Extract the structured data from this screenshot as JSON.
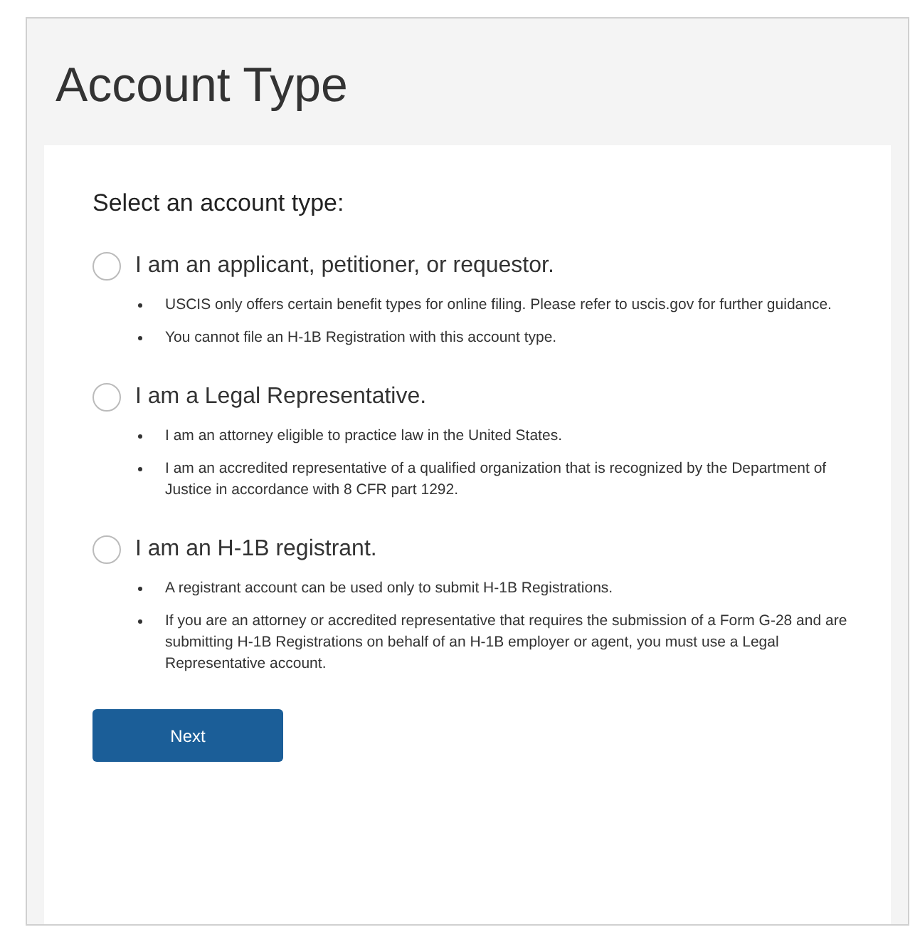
{
  "title": "Account Type",
  "prompt": "Select an account type:",
  "options": [
    {
      "label": "I am an applicant, petitioner, or requestor.",
      "selected": false,
      "bullets": [
        "USCIS only offers certain benefit types for online filing. Please refer to uscis.gov for further guidance.",
        "You cannot file an H-1B Registration with this account type."
      ]
    },
    {
      "label": "I am a Legal Representative.",
      "selected": false,
      "bullets": [
        "I am an attorney eligible to practice law in the United States.",
        "I am an accredited representative of a qualified organization that is recognized by the Department of Justice in accordance with 8 CFR part 1292."
      ]
    },
    {
      "label": "I am an H-1B registrant.",
      "selected": false,
      "bullets": [
        "A registrant account can be used only to submit H-1B Registrations.",
        "If you are an attorney or accredited representative that requires the submission of a Form G-28 and are submitting H-1B Registrations on behalf of an H-1B employer or agent, you must use a Legal Representative account."
      ]
    }
  ],
  "button": "Next"
}
